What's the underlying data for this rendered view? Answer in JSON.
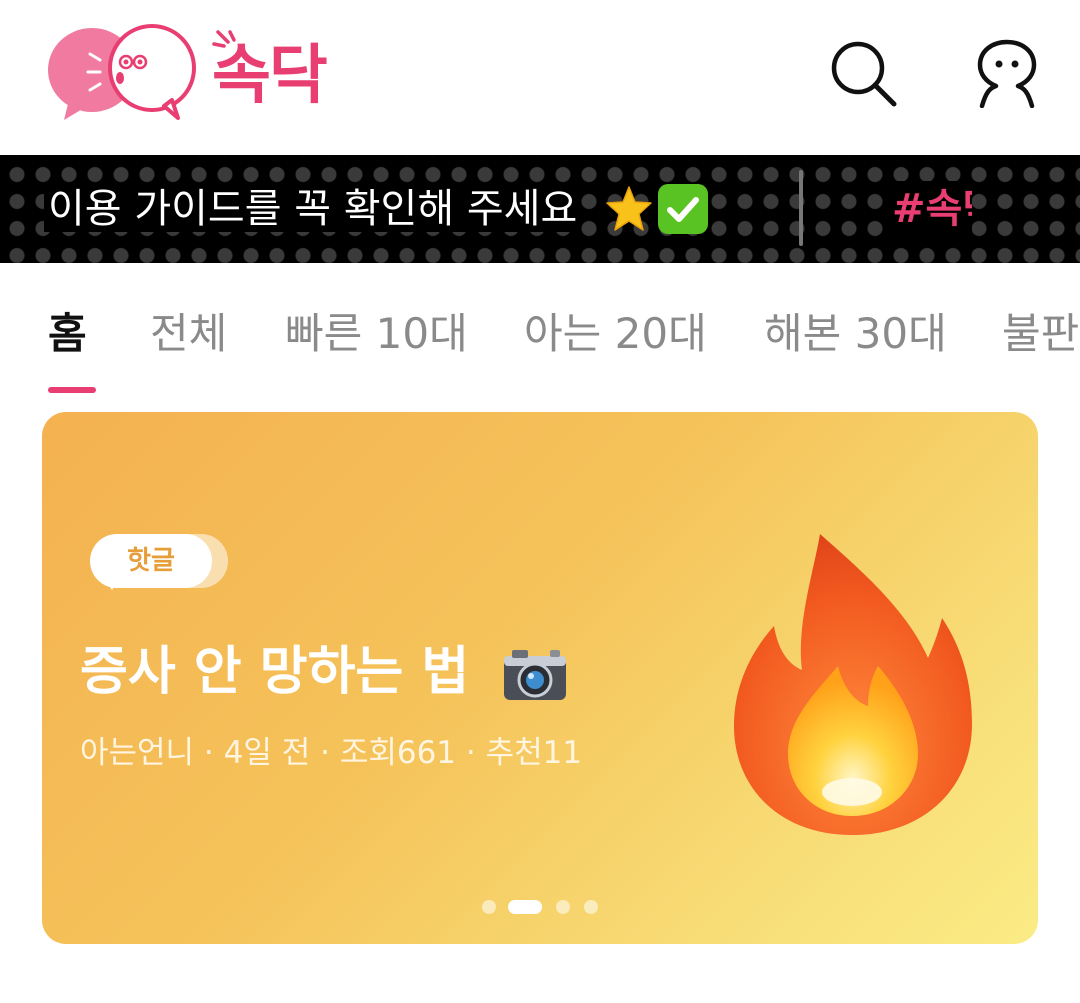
{
  "app": {
    "logo_text": "속닥"
  },
  "header": {
    "icons": [
      "search-icon",
      "profile-icon"
    ]
  },
  "ticker": {
    "notice": "이용 가이드를 꼭 확인해 주세요",
    "emojis": [
      "star-emoji",
      "check-mark-emoji"
    ],
    "hashtag": "#속닥"
  },
  "tabs": [
    {
      "label": "홈",
      "active": true
    },
    {
      "label": "전체",
      "active": false
    },
    {
      "label": "빠른 10대",
      "active": false
    },
    {
      "label": "아는 20대",
      "active": false
    },
    {
      "label": "해본 30대",
      "active": false
    },
    {
      "label": "불판",
      "active": false
    }
  ],
  "banner": {
    "badge": "핫글",
    "title": "증사 안 망하는 법",
    "title_emoji": "camera-emoji",
    "meta": "아는언니 · 4일 전 · 조회661 · 추천11",
    "illustration": "fire-emoji",
    "page_count": 4,
    "current_page": 2
  },
  "colors": {
    "brand": "#e83e72",
    "ticker_bg": "#000000",
    "banner_gradient_start": "#f4b150",
    "banner_gradient_end": "#fbec85"
  }
}
